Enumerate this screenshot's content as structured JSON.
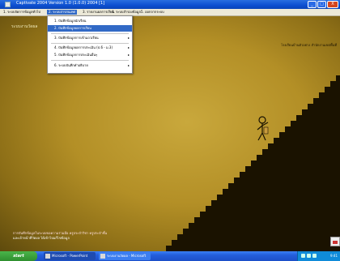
{
  "window": {
    "title": "Captivate 2004 Version 1.0 (1.0.0) 2004 [1]",
    "controls": {
      "minimize": "_",
      "maximize": "□",
      "close": "X"
    }
  },
  "menubar": {
    "items": [
      {
        "label": "1. ระบบจัดการข้อมูลทั่วไป"
      },
      {
        "label": "2. ระบบสารสนเทศ"
      },
      {
        "label": "3. รายงานผลการเรียน"
      },
      {
        "label": "4. ระบบสำรองข้อมูล"
      },
      {
        "label": "5. ออกจากระบบ"
      }
    ]
  },
  "dropdown": {
    "items": [
      {
        "label": "1. บันทึกข้อมูลนักเรียน",
        "has_submenu": false,
        "highlighted": false
      },
      {
        "label": "2. บันทึกข้อมูลผลการเรียน",
        "has_submenu": false,
        "highlighted": true
      },
      {
        "label": "3. บันทึกข้อมูลการเข้าแถวเรียน",
        "has_submenu": true,
        "highlighted": false
      },
      {
        "label": "4. บันทึกข้อมูลผลการประเมิน (ป.6 - ม.3)",
        "has_submenu": true,
        "highlighted": false
      },
      {
        "label": "5. บันทึกข้อมูลการประเมินอื่นๆ",
        "has_submenu": true,
        "highlighted": false
      },
      {
        "label": "6. ระบบบันทึกคำอธิบาย",
        "has_submenu": true,
        "highlighted": false
      }
    ],
    "arrow": "▸"
  },
  "content": {
    "topleft_label": "ระบบงานวัดผล",
    "topright_label": "โรงเรียนบ้านตัวอย่าง สำนักงานเขตพื้นที่",
    "bottom_lines": [
      "การบันทึกข้อมูลในระบบขอความร่วมมือ ครูประจำวิชา ครูประจำชั้น",
      "และเจ้าหน้าที่วัดผล ได้เข้าไปแก้ไขข้อมูล"
    ]
  },
  "taskbar": {
    "start_label": "start",
    "tasks": [
      {
        "label": "Microsoft - PowerPoint",
        "active": true
      },
      {
        "label": "ระบบงานวัดผล - Microsoft",
        "active": false
      }
    ],
    "clock": "9:41"
  },
  "colors": {
    "accent": "#3169c6",
    "background": "#b38f26",
    "stairs": "#1a1200"
  }
}
